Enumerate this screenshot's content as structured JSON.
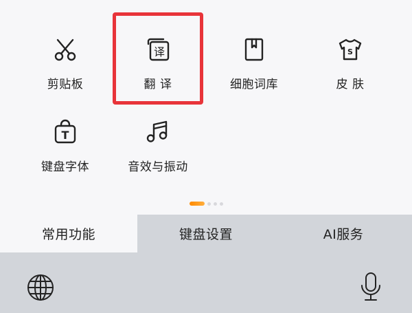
{
  "toolbox": {
    "items": [
      {
        "label": "剪贴板",
        "icon": "scissors-icon"
      },
      {
        "label": "翻 译",
        "icon": "translate-icon"
      },
      {
        "label": "细胞词库",
        "icon": "bookmark-book-icon"
      },
      {
        "label": "皮 肤",
        "icon": "tshirt-icon"
      },
      {
        "label": "键盘字体",
        "icon": "font-bag-icon"
      },
      {
        "label": "音效与振动",
        "icon": "music-note-icon"
      }
    ],
    "translate_glyph": "译",
    "font_glyph": "T",
    "skin_glyph": "S",
    "highlight_color": "#e8343a"
  },
  "pager": {
    "page_count": 4,
    "current_page": 1,
    "active_color": "#ff8a00"
  },
  "tabs": [
    {
      "label": "常用功能",
      "active": true
    },
    {
      "label": "键盘设置",
      "active": false
    },
    {
      "label": "AI服务",
      "active": false
    }
  ],
  "bottom_bar": {
    "left_icon": "globe-icon",
    "right_icon": "microphone-icon"
  }
}
